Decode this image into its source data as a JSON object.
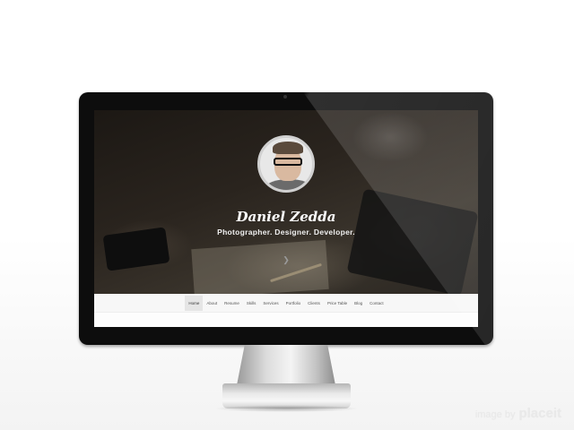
{
  "profile": {
    "name": "Daniel Zedda",
    "tagline": "Photographer. Designer. Developer."
  },
  "nav": {
    "items": [
      "Home",
      "About",
      "Resume",
      "Skills",
      "Services",
      "Portfolio",
      "Clients",
      "Price Table",
      "Blog",
      "Contact"
    ],
    "active": "Home"
  },
  "icons": {
    "scroll": "chevron-down-icon"
  },
  "credit": {
    "prefix": "image by",
    "brand": "placeit"
  },
  "colors": {
    "bezel": "#0d0d0d",
    "nav_bg": "#f7f7f7",
    "hero_text": "#ffffff"
  }
}
